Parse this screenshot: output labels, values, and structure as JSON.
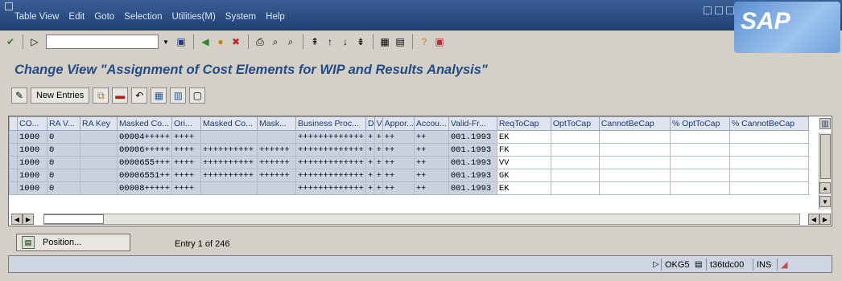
{
  "menu": [
    "Table View",
    "Edit",
    "Goto",
    "Selection",
    "Utilities(M)",
    "System",
    "Help"
  ],
  "logo": "SAP",
  "title": "Change View \"Assignment of Cost Elements for WIP and Results Analysis\"",
  "app_toolbar": {
    "new_entries": "New Entries"
  },
  "table": {
    "columns": [
      "CO...",
      "RA V...",
      "RA Key",
      "Masked Co...",
      "Ori...",
      "Masked Co...",
      "Mask...",
      "Business Proc...",
      "D",
      "V",
      "Appor...",
      "Accou...",
      "Valid-Fr...",
      "ReqToCap",
      "OptToCap",
      "CannotBeCap",
      "% OptToCap",
      "% CannotBeCap"
    ],
    "rows": [
      [
        "1000",
        "0",
        "",
        "00004+++++",
        "++++",
        "",
        "",
        "+++++++++++++",
        "+",
        "+",
        "++",
        "++",
        "001.1993",
        "EK",
        "",
        "",
        "",
        ""
      ],
      [
        "1000",
        "0",
        "",
        "00006+++++",
        "++++",
        "++++++++++",
        "++++++",
        "+++++++++++++",
        "+",
        "+",
        "++",
        "++",
        "001.1993",
        "FK",
        "",
        "",
        "",
        ""
      ],
      [
        "1000",
        "0",
        "",
        "0000655+++",
        "++++",
        "++++++++++",
        "++++++",
        "+++++++++++++",
        "+",
        "+",
        "++",
        "++",
        "001.1993",
        "VV",
        "",
        "",
        "",
        ""
      ],
      [
        "1000",
        "0",
        "",
        "00006551++",
        "++++",
        "++++++++++",
        "++++++",
        "+++++++++++++",
        "+",
        "+",
        "++",
        "++",
        "001.1993",
        "GK",
        "",
        "",
        "",
        ""
      ],
      [
        "1000",
        "0",
        "",
        "00008+++++",
        "++++",
        "",
        "",
        "+++++++++++++",
        "+",
        "+",
        "++",
        "++",
        "001.1993",
        "EK",
        "",
        "",
        "",
        ""
      ]
    ]
  },
  "position_label": "Position...",
  "entry_text": "Entry 1 of 246",
  "status": {
    "transaction": "OKG5",
    "server": "t36tdc00",
    "mode": "INS"
  }
}
